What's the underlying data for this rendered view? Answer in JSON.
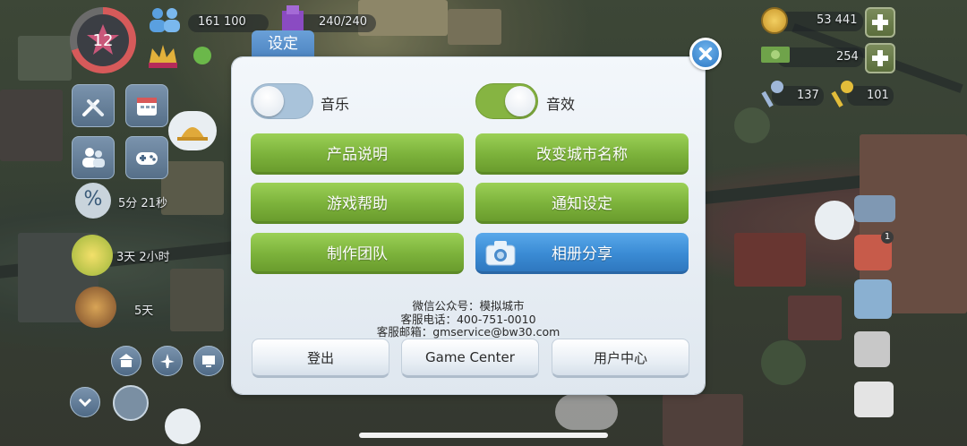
{
  "hud": {
    "level": "12",
    "population": "161 100",
    "storage": "240/240",
    "simoleons": "53 441",
    "bucks": "254",
    "keys_platinum": "137",
    "keys_golden": "101",
    "timer_discount": "5分 21秒",
    "timer_park": "3天 2小时",
    "timer_event": "5天",
    "notif_count": "1"
  },
  "dialog": {
    "tab_title": "设定",
    "music_label": "音乐",
    "music_on": false,
    "sfx_label": "音效",
    "sfx_on": true,
    "buttons": {
      "product_info": "产品说明",
      "rename_city": "改变城市名称",
      "game_help": "游戏帮助",
      "notification_settings": "通知设定",
      "credits": "制作团队",
      "album_share": "相册分享"
    },
    "info_lines": {
      "wechat": "微信公众号：模拟城市",
      "phone": "客服电话：400-751-0010",
      "email": "客服邮箱：gmservice@bw30.com"
    },
    "bottom": {
      "logout": "登出",
      "game_center": "Game Center",
      "user_center": "用户中心"
    }
  },
  "colors": {
    "toggle_off": "#a9c3da",
    "toggle_on": "#86b442",
    "green_button": "#7cb23b",
    "blue_button": "#3a8bd4",
    "dialog_bg": "#eef3f8"
  }
}
